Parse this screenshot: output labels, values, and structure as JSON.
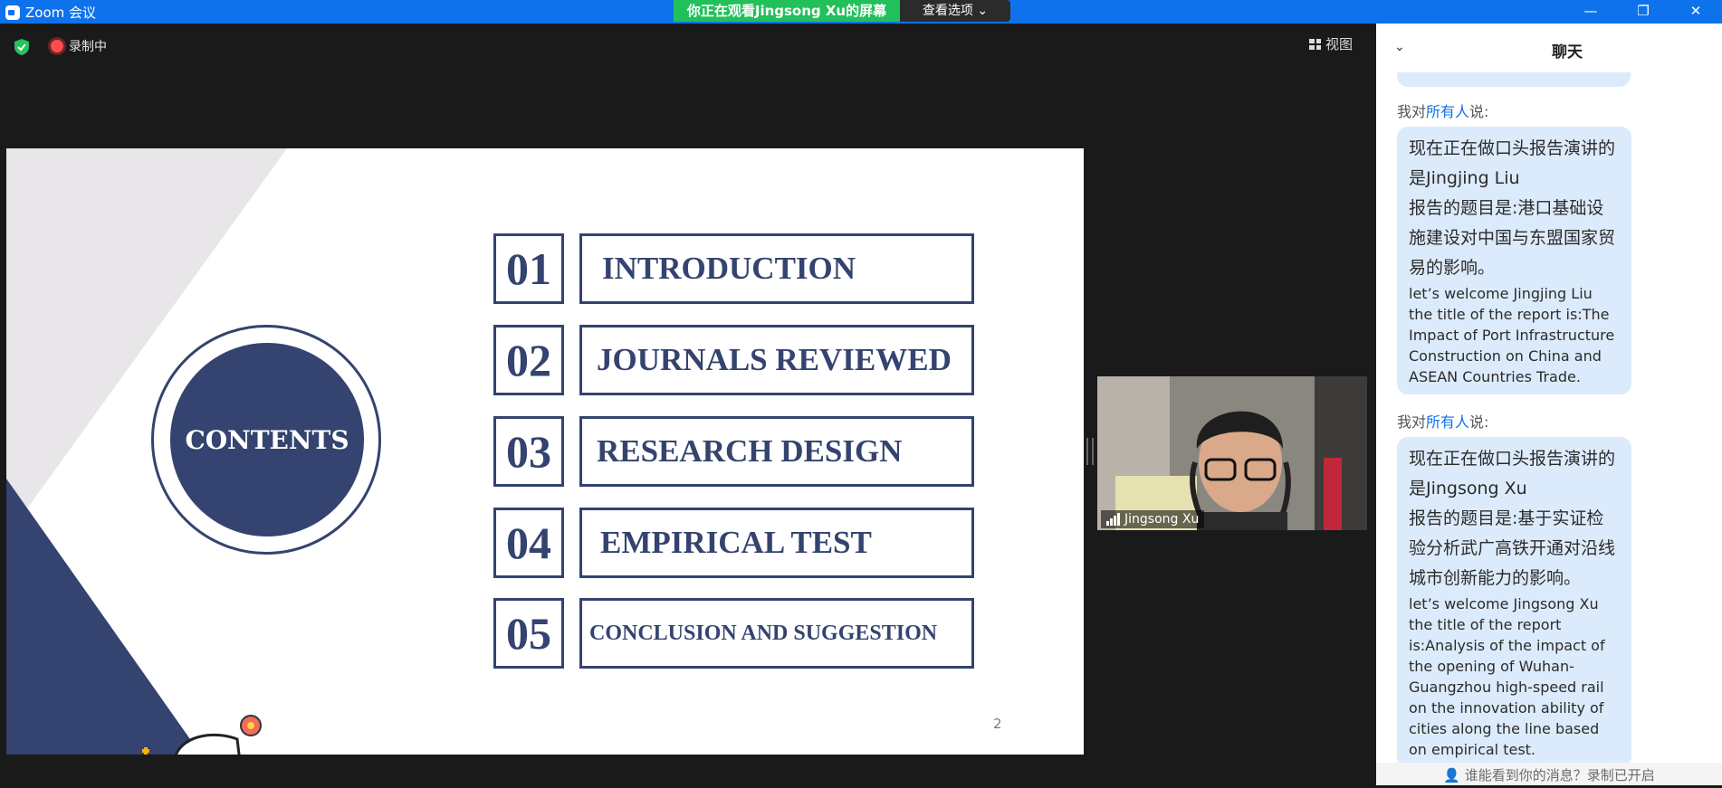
{
  "window": {
    "title": "Zoom 会议"
  },
  "share_banner": {
    "text": "你正在观看Jingsong  Xu的屏幕",
    "options_label": "查看选项"
  },
  "window_controls": {
    "minimize": "—",
    "maximize": "❐",
    "close": "✕"
  },
  "toolbar": {
    "recording_label": "录制中",
    "view_label": "视图"
  },
  "slide": {
    "contents_label": "CONTENTS",
    "items": [
      {
        "num": "01",
        "label": "INTRODUCTION"
      },
      {
        "num": "02",
        "label": "JOURNALS REVIEWED"
      },
      {
        "num": "03",
        "label": "RESEARCH DESIGN"
      },
      {
        "num": "04",
        "label": "EMPIRICAL TEST"
      },
      {
        "num": "05",
        "label": "CONCLUSION AND SUGGESTION"
      }
    ],
    "page_number": "2",
    "colors": {
      "navy": "#34436f",
      "light_gray": "#e8e6e9"
    }
  },
  "video": {
    "participant_name": "Jingsong Xu"
  },
  "chat": {
    "title": "聊天",
    "messages": [
      {
        "sender_prefix": "我对",
        "sender_to": "所有人",
        "sender_suffix": "说:",
        "zh_lines": [
          "现在正在做口头报告演讲的是Jingjing Liu",
          "报告的题目是:港口基础设施建设对中国与东盟国家贸易的影响。"
        ],
        "en_lines": [
          "let’s welcome Jingjing Liu",
          "the title of the report is:The Impact of Port Infrastructure Construction on China and ASEAN Countries Trade."
        ]
      },
      {
        "sender_prefix": "我对",
        "sender_to": "所有人",
        "sender_suffix": "说:",
        "zh_lines": [
          "现在正在做口头报告演讲的是Jingsong Xu",
          "报告的题目是:基于实证检验分析武广高铁开通对沿线城市创新能力的影响。"
        ],
        "en_lines": [
          "let’s welcome Jingsong Xu",
          "the title of the report is:Analysis of the impact of the opening of Wuhan-Guangzhou high-speed rail on the innovation ability of cities along the line based on empirical test."
        ]
      }
    ],
    "footer_text": "谁能看到你的消息？录制已开启"
  }
}
